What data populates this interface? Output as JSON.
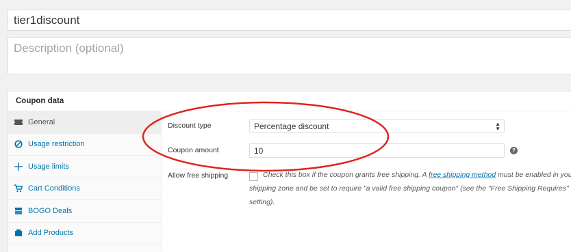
{
  "title_field": {
    "value": "tier1discount"
  },
  "description_field": {
    "placeholder": "Description (optional)"
  },
  "coupon_panel": {
    "title": "Coupon data",
    "tabs": [
      {
        "label": "General",
        "icon": "ticket-icon",
        "active": true
      },
      {
        "label": "Usage restriction",
        "icon": "no-entry-icon"
      },
      {
        "label": "Usage limits",
        "icon": "crosshair-icon"
      },
      {
        "label": "Cart Conditions",
        "icon": "cart-icon"
      },
      {
        "label": "BOGO Deals",
        "icon": "deals-icon"
      },
      {
        "label": "Add Products",
        "icon": "products-icon"
      }
    ],
    "discount_type": {
      "label": "Discount type",
      "value": "Percentage discount"
    },
    "coupon_amount": {
      "label": "Coupon amount",
      "value": "10"
    },
    "free_shipping": {
      "label": "Allow free shipping",
      "text_before": "Check this box if the coupon grants free shipping. A ",
      "link_text": "free shipping method",
      "text_after": " must be enabled in your shipping zone and be set to require \"a valid free shipping coupon\" (see the \"Free Shipping Requires\" setting)."
    }
  },
  "annotation": {
    "color": "#e0241b"
  },
  "colors": {
    "link": "#0073aa",
    "active_tab_bg": "#eeeeee"
  }
}
